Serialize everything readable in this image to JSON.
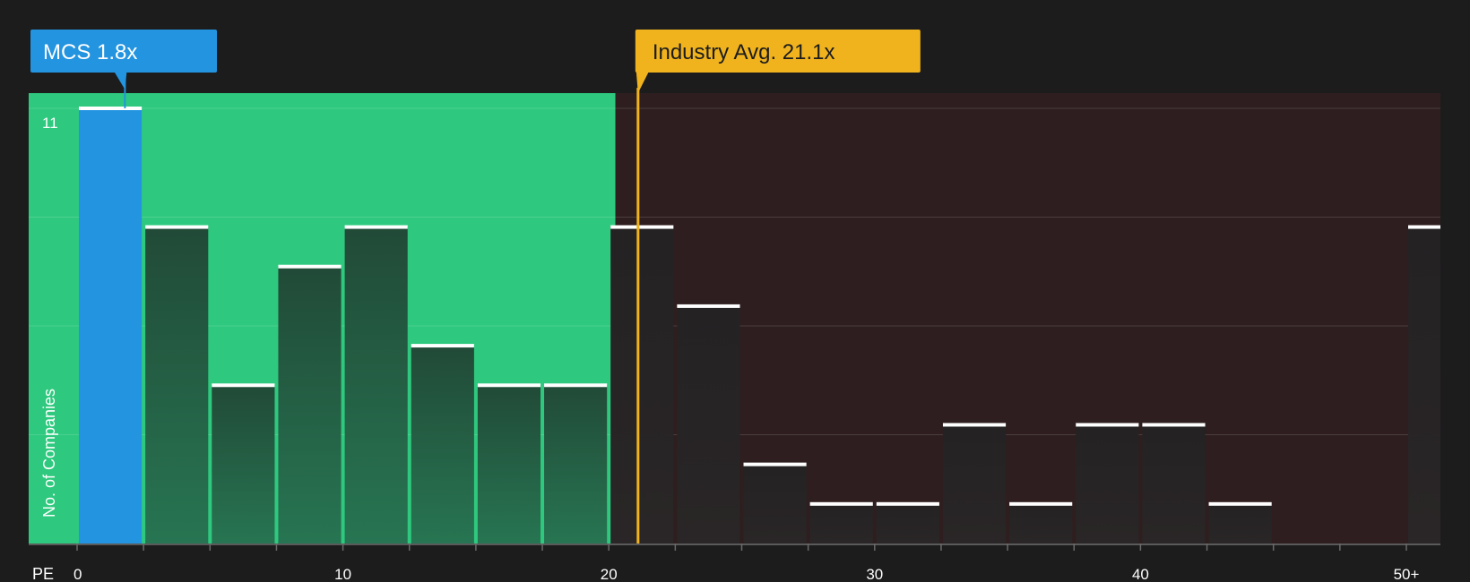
{
  "chart_data": {
    "type": "bar",
    "x_axis_label": "PE",
    "y_axis_label": "No. of Companies",
    "y_max_tick_label": "11",
    "x_tick_labels": [
      "0",
      "10",
      "20",
      "30",
      "40",
      "50+"
    ],
    "x_ticks": [
      0,
      10,
      20,
      30,
      40,
      50
    ],
    "bin_width": 2.5,
    "bin_starts": [
      0,
      2.5,
      5,
      7.5,
      10,
      12.5,
      15,
      17.5,
      20,
      22.5,
      25,
      27.5,
      30,
      32.5,
      35,
      37.5,
      40,
      42.5,
      45,
      47.5,
      50
    ],
    "values": [
      11,
      8,
      4,
      7,
      8,
      5,
      4,
      4,
      8,
      6,
      2,
      1,
      1,
      3,
      1,
      3,
      3,
      1,
      0,
      0,
      8
    ],
    "y_grid_values": [
      0,
      2.75,
      5.5,
      8.25,
      11
    ],
    "x_max": 51.3,
    "y_max": 11,
    "highlight_bin_index": 0,
    "fair_value_threshold": 20.25,
    "company": {
      "label": "MCS 1.8x",
      "pe": 1.8
    },
    "industry": {
      "label": "Industry Avg. 21.1x",
      "pe": 21.1
    },
    "colors": {
      "background": "#1c1c1d",
      "green_zone": "#2ec97e",
      "red_zone": "#2e1e1f",
      "company": "#2394e0",
      "industry": "#f0b31e",
      "bar_top": "#ffffff"
    }
  }
}
